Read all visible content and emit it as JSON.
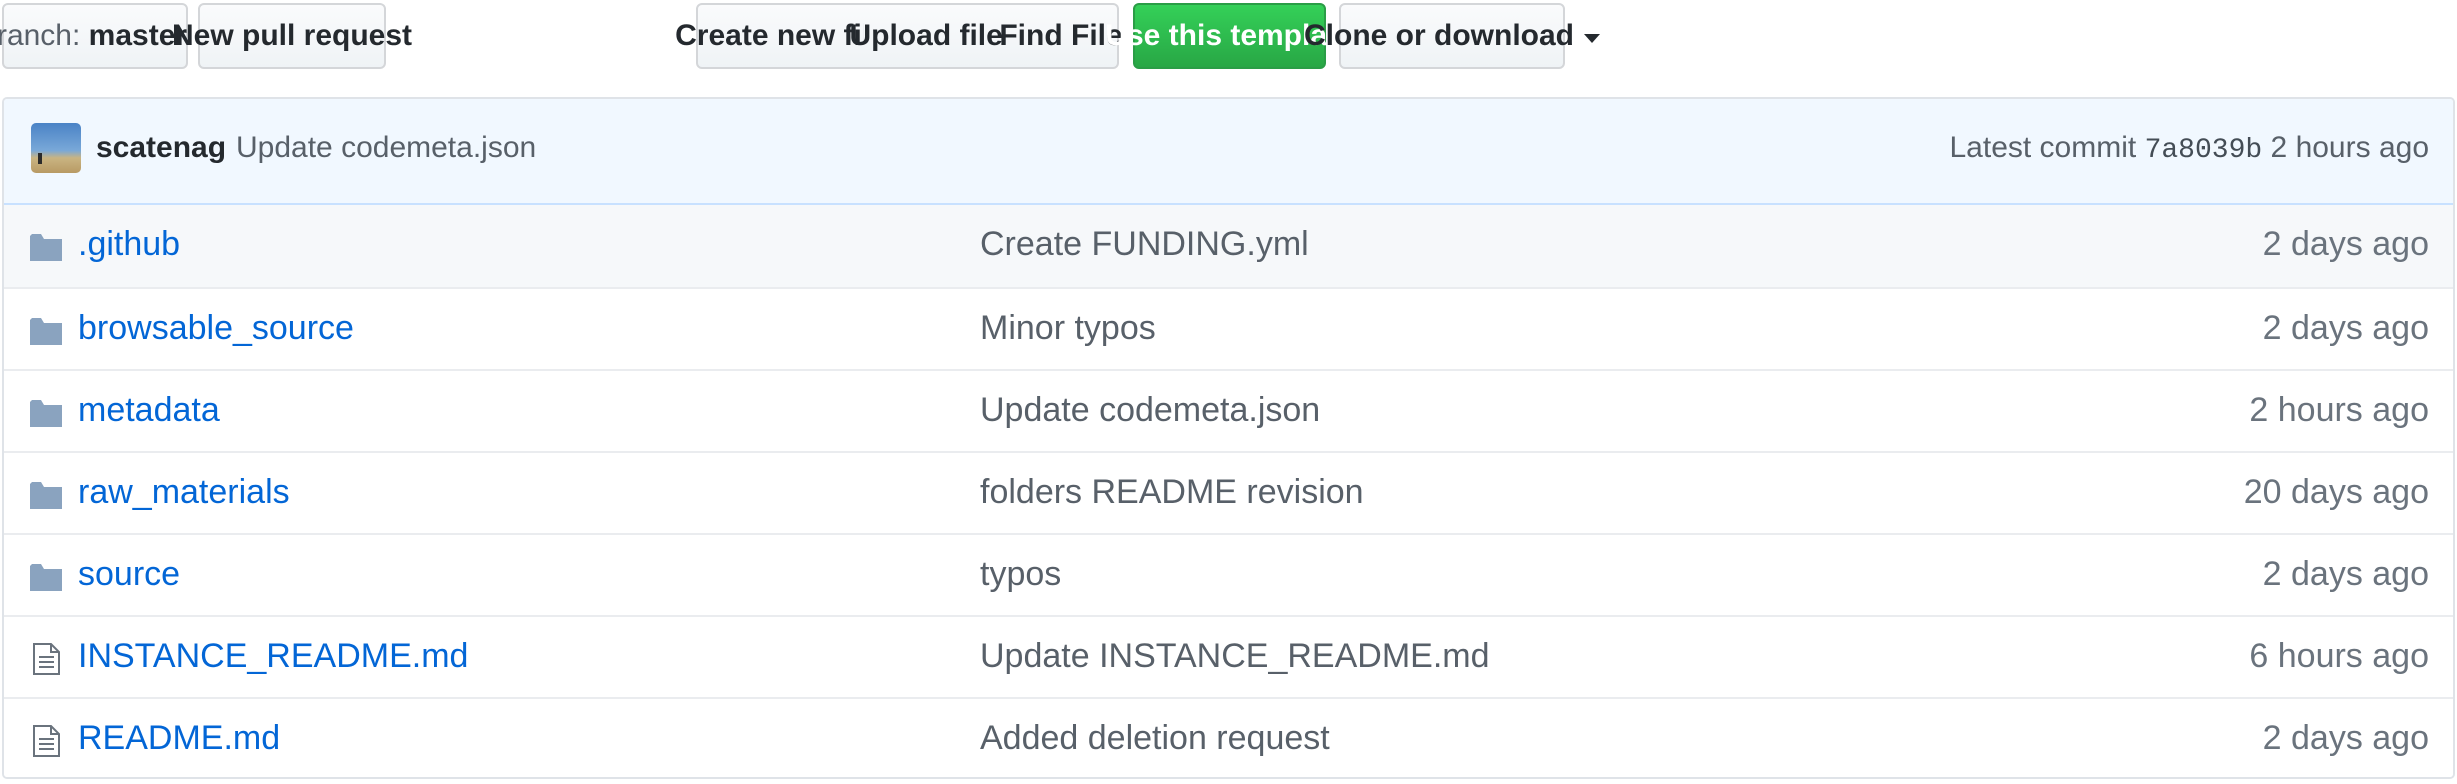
{
  "toolbar": {
    "branch_prefix": "Branch:",
    "branch_name": "master",
    "new_pull_request": "New pull request",
    "create_new_file": "Create new file",
    "upload_files": "Upload files",
    "find_file": "Find File",
    "use_template": "Use this template",
    "clone_download": "Clone or download"
  },
  "commit": {
    "author": "scatenag",
    "message": "Update codemeta.json",
    "latest_label": "Latest commit",
    "sha": "7a8039b",
    "age": "2 hours ago"
  },
  "files": [
    {
      "type": "folder",
      "name": ".github",
      "message": "Create FUNDING.yml",
      "age": "2 days ago"
    },
    {
      "type": "folder",
      "name": "browsable_source",
      "message": "Minor typos",
      "age": "2 days ago"
    },
    {
      "type": "folder",
      "name": "metadata",
      "message": "Update codemeta.json",
      "age": "2 hours ago"
    },
    {
      "type": "folder",
      "name": "raw_materials",
      "message": "folders README revision",
      "age": "20 days ago"
    },
    {
      "type": "folder",
      "name": "source",
      "message": "typos",
      "age": "2 days ago"
    },
    {
      "type": "file",
      "name": "INSTANCE_README.md",
      "message": "Update INSTANCE_README.md",
      "age": "6 hours ago"
    },
    {
      "type": "file",
      "name": "README.md",
      "message": "Added deletion request",
      "age": "2 days ago"
    }
  ],
  "colors": {
    "link": "#0366d6",
    "green": "#28a745",
    "folder": "#79b8ff",
    "commit_bg": "#f1f8ff"
  }
}
